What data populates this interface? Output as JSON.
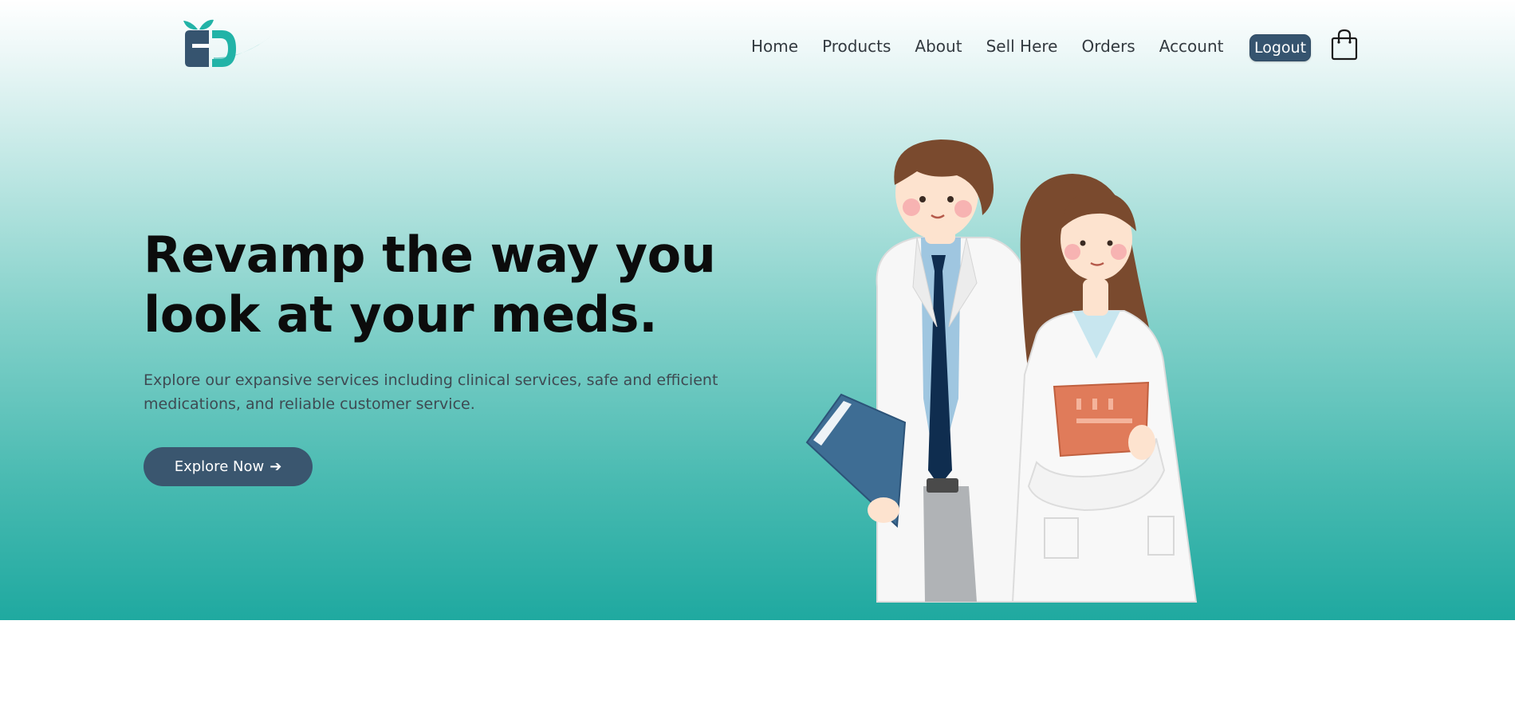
{
  "nav": {
    "links": [
      "Home",
      "Products",
      "About",
      "Sell Here",
      "Orders",
      "Account"
    ],
    "logout_label": "Logout",
    "icons": {
      "logo": "pharmacy-logo",
      "cart": "shopping-bag-icon"
    }
  },
  "hero": {
    "headline_line1": "Revamp the way you",
    "headline_line2": "look at your meds.",
    "subtext": "Explore our expansive services including clinical services, safe and efficient medications, and reliable customer service.",
    "cta_label": "Explore Now",
    "cta_arrow": "➔",
    "illustration": "two-doctors-illustration"
  },
  "colors": {
    "accent": "#1fa9a0",
    "button": "#3a566f",
    "logo_dark": "#36546f",
    "logo_teal": "#22b3a7"
  }
}
